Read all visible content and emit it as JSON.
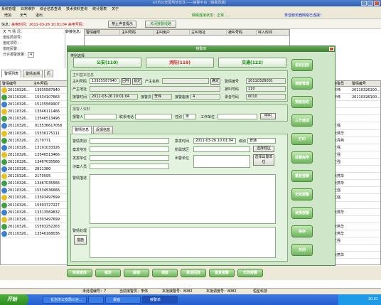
{
  "window": {
    "title": "XX市公安局刑侦支队——接警平台（接警员版）"
  },
  "menubar": {
    "items": [
      "系统管理",
      "日常维护",
      "综合信息查询",
      "技术资料查询",
      "统计报表",
      "关于"
    ]
  },
  "toolbar": {
    "items": [
      "增加",
      "天气",
      "退出"
    ]
  },
  "status": {
    "network": "网络连接状态：正常......",
    "server": "录音服务器网络已连接！"
  },
  "top_strip": {
    "info_label": "信息：",
    "call_time": "来电时间：2011-03-26 10:01:04 来电号码：",
    "btn_stop_sound": "禁止声音提示",
    "btn_block_line": "关闭接警线路",
    "transfer_label": "转接信息："
  },
  "left_info": {
    "weather": "天 气 情 况：",
    "notify1": "值班局领导：",
    "notify2": "值班领导：",
    "notify3": "值班民警：",
    "alarm_count": "允许报警数量：",
    "alarm_count_value": "4"
  },
  "left_tabs": [
    "警情列表",
    "警情追溯",
    "历"
  ],
  "left_grid": {
    "headers": [
      "警情编号",
      "主叫号码"
    ],
    "rows": [
      [
        "20110326...",
        "13935587940"
      ],
      [
        "20110326...",
        "15534107663"
      ],
      [
        "20110326...",
        "15135569907"
      ],
      [
        "20110326...",
        "13546111466"
      ],
      [
        "20110326...",
        "13546513496"
      ],
      [
        "20110326...",
        "015536617058"
      ],
      [
        "20110326...",
        "15536175111"
      ],
      [
        "20110326...",
        "2179771"
      ],
      [
        "20110326...",
        "13191033326"
      ],
      [
        "20110326...",
        "13546513466"
      ],
      [
        "20110326...",
        "13467035566"
      ],
      [
        "20110326...",
        "2811380"
      ],
      [
        "20110326...",
        "2170595"
      ],
      [
        "20110326...",
        "13467035566"
      ],
      [
        "20110326...",
        "15534536666"
      ],
      [
        "20110326...",
        "13303497699"
      ],
      [
        "20110326...",
        "15593727227"
      ],
      [
        "20110326...",
        "13313569832"
      ],
      [
        "20110326...",
        "13303497699"
      ],
      [
        "20110326...",
        "15593252263"
      ],
      [
        "20110326...",
        "13546168036"
      ]
    ]
  },
  "top_grid": {
    "headers": [
      "警情编号",
      "主叫号码",
      "主叫用户",
      "主叫地址",
      "被叫号码",
      "呼入时间"
    ]
  },
  "right_grid": {
    "headers": [
      "接警员",
      "警情编号"
    ],
    "rows": [
      [
        "李伟",
        "20110326100..."
      ],
      [
        "李伟",
        "20110326100..."
      ],
      [
        "",
        ""
      ],
      [
        "",
        ""
      ],
      [
        "",
        ""
      ],
      [
        "王强",
        ""
      ],
      [
        "张燕华",
        ""
      ],
      [
        "朱丹燕",
        ""
      ],
      [
        "王强",
        ""
      ],
      [
        "王强",
        ""
      ],
      [
        "王强",
        ""
      ],
      [
        "",
        ""
      ],
      [
        "张燕华",
        ""
      ],
      [
        "张燕华",
        ""
      ],
      [
        "王强",
        ""
      ],
      [
        "王强",
        ""
      ],
      [
        "",
        ""
      ],
      [
        "张燕华",
        ""
      ],
      [
        "",
        ""
      ],
      [
        "张燕华",
        ""
      ],
      [
        "张燕华",
        ""
      ],
      [
        "王强",
        ""
      ],
      [
        "",
        ""
      ],
      [
        "张燕华",
        ""
      ]
    ]
  },
  "dialog": {
    "title": "接警单",
    "category_label": "类别选择",
    "cat_police": "公安(110)",
    "cat_fire": "消防(119)",
    "cat_traffic": "交通(122)",
    "basic_label": "主叫基本信息",
    "caller_no_label": "主叫号码",
    "caller_no": "13935587940",
    "btn_return_call": "回呼",
    "btn_lock": "锁定",
    "owner_label": "产主名称",
    "addr_label": "产主地址",
    "time_label": "接警时间",
    "time_value": "2011-03-26 10:01:04",
    "operator_label": "接警员",
    "operator_value": "李伟",
    "seat_label": "接警座席",
    "seat_value": "4",
    "btn_ok": "确定",
    "case_no_label": "警情编号",
    "case_no": "20110326001",
    "called_no_label": "被叫号码",
    "called_no": "110",
    "record_label": "录音号码",
    "record_no": "0010",
    "reporter_section": "报警人资料",
    "reporter_label": "报警人",
    "contact_label": "联系电话",
    "gender_label": "性别",
    "gender_value": "男",
    "work_label": "工作单位",
    "btn_callback": "呼叫",
    "tab_info": "警情信息",
    "tab_feedback": "反馈信息",
    "type_label": "警情类别",
    "loc_label": "案发地址",
    "area_label": "发案单位",
    "persons_label": "涉案人员",
    "occur_time_label": "案发时间",
    "occur_time": "2011-03-26 10:01:04",
    "level_label": "级别",
    "level_value": "普通",
    "dispatch_label": "所属辖区",
    "btn_select_area": "选择辖区",
    "dept_label": "出警单位",
    "btn_add_dept": "选择出警单位",
    "desc_label": "警情描述",
    "result_label": "警情处理",
    "btn_result": "措施"
  },
  "side_buttons": [
    "语音回放",
    "调度管理",
    "预案指导",
    "三方通话",
    "打印",
    "处警完毕",
    "重复报警",
    "无效报警",
    "误报报警",
    "保存",
    "关闭"
  ],
  "bottom_buttons": [
    "快速查找",
    "锁定",
    "解锁",
    "调度",
    "录音回放",
    "重复报警",
    "无效报警"
  ],
  "statusbar": {
    "s1": "未处理编号：7",
    "s2": "当前接警员：李伟",
    "s3": "本批接警号：8082",
    "s4": "本批调度号：8082",
    "s5": "恒星科技"
  },
  "taskbar": {
    "start": "开始",
    "tasks": [
      "长治市公安局三台...",
      "",
      "桌面",
      "接警单"
    ],
    "clock": "10:01"
  },
  "colors": {
    "accent": "#6db45c",
    "dialog_bg": "#cfe6c8",
    "titlebar": "#2f5faf",
    "police": "#0a8a0a",
    "fire": "#c82020",
    "traffic": "#0a8a0a"
  }
}
